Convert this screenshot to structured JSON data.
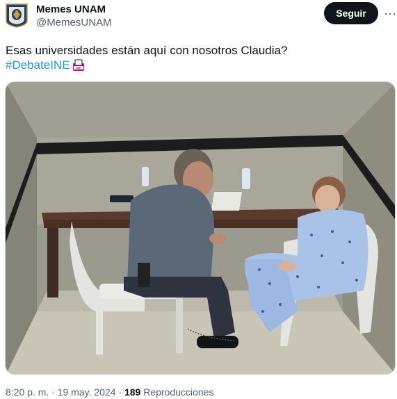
{
  "tweet": {
    "author_name": "Memes UNAM",
    "handle": "@MemesUNAM",
    "follow_label": "Seguir",
    "text": "Esas universidades están aquí con nosotros Claudia?",
    "hashtag": "#DebateINE",
    "time": "8:20 p. m.",
    "separator": "·",
    "date": "19 may. 2024",
    "views_count": "189",
    "views_label": "Reproducciones",
    "emoji_text": "INE"
  },
  "icons": [
    "unam-crest-avatar",
    "more-options-icon",
    "ine-ballot-emoji"
  ]
}
